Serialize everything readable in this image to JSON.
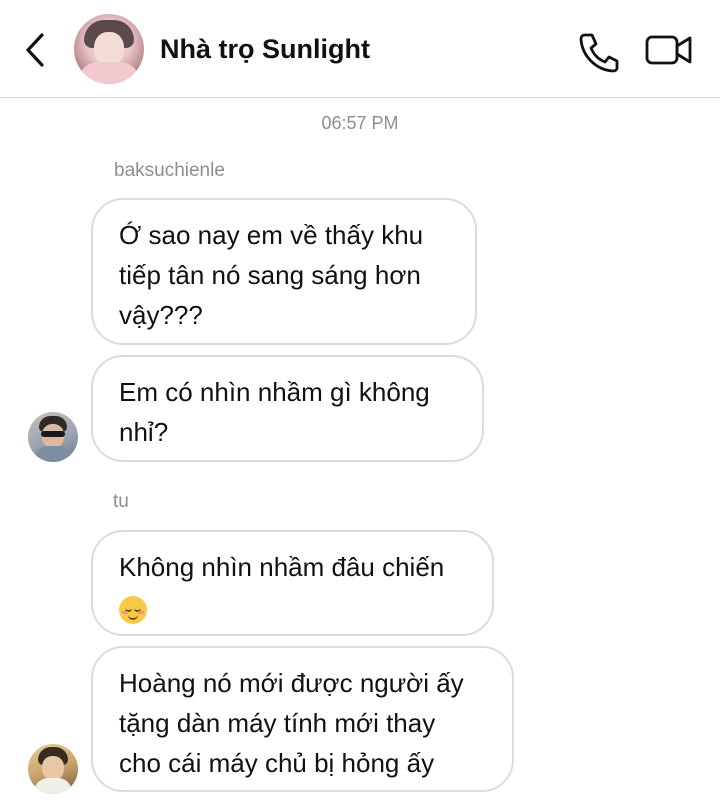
{
  "header": {
    "title": "Nhà trọ Sunlight",
    "back_icon": "chevron-left-icon",
    "call_icon": "phone-icon",
    "video_icon": "video-camera-icon"
  },
  "chat": {
    "timestamp": "06:57 PM",
    "groups": [
      {
        "sender": "baksuchienle",
        "messages": [
          {
            "lines": [
              "Ớ sao nay em về thấy khu",
              "tiếp tân nó sang sáng hơn",
              "vậy???"
            ]
          },
          {
            "lines": [
              "Em có nhìn nhầm gì không",
              "nhỉ?"
            ]
          }
        ]
      },
      {
        "sender": "tu",
        "messages": [
          {
            "lines": [
              "Không nhìn nhầm đâu chiến"
            ],
            "emoji": "relieved-face-emoji"
          },
          {
            "lines": [
              "Hoàng nó mới được người ấy",
              "tặng dàn máy tính mới thay",
              "cho cái máy chủ bị hỏng ấy"
            ]
          }
        ]
      }
    ]
  },
  "colors": {
    "bubble_border": "#dcdcdc",
    "meta_text": "#8e8e8e",
    "text": "#111111"
  }
}
